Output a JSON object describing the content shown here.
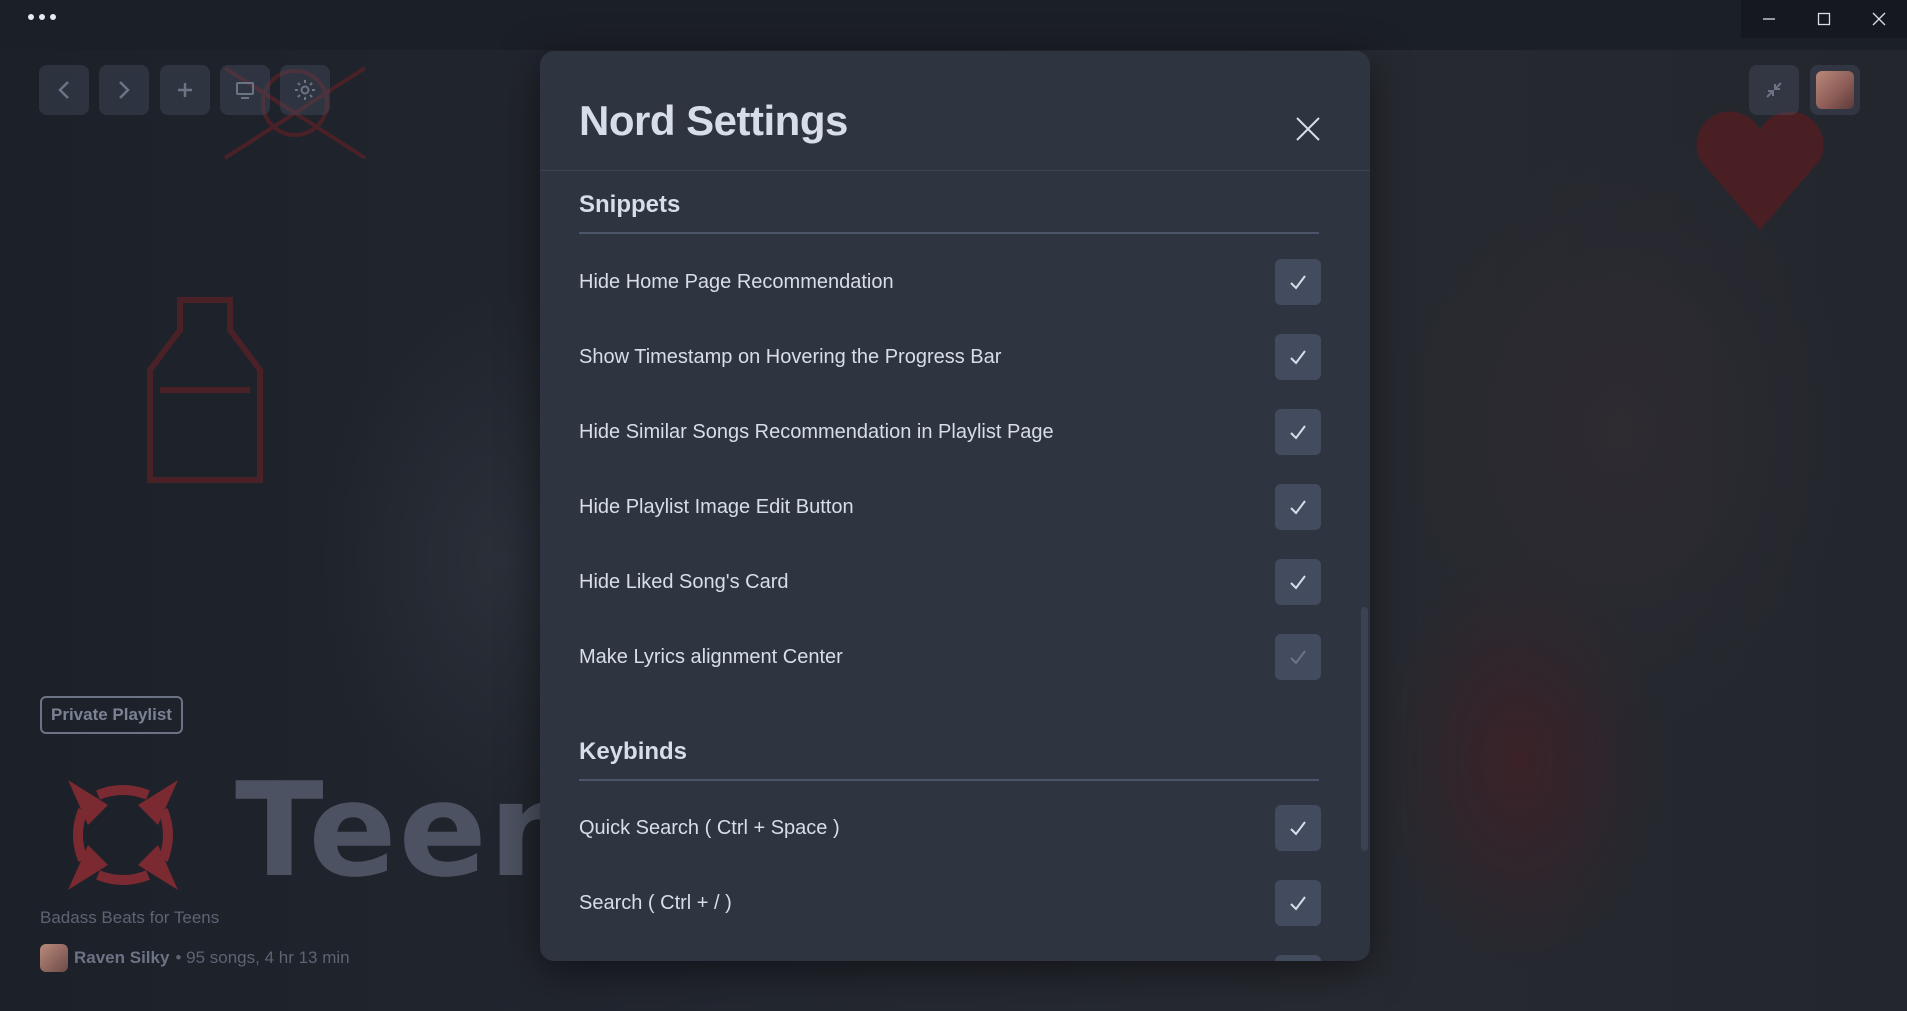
{
  "window": {
    "menu_icon": "more-dots-icon",
    "controls": [
      "minimize-icon",
      "maximize-icon",
      "close-icon"
    ]
  },
  "topbar": {
    "buttons": [
      "back-icon",
      "forward-icon",
      "plus-icon",
      "monitor-icon",
      "gear-icon"
    ],
    "right_buttons": [
      "minimize-arrows-icon",
      "user-avatar"
    ]
  },
  "playlist": {
    "badge": "Private Playlist",
    "title": "Teen",
    "description": "Badass Beats for Teens",
    "owner": "Raven Silky",
    "meta": "• 95 songs, 4 hr 13 min"
  },
  "modal": {
    "title": "Nord Settings",
    "sections": [
      {
        "title": "Snippets",
        "items": [
          {
            "label": "Hide Home Page Recommendation",
            "checked": true
          },
          {
            "label": "Show Timestamp on Hovering the Progress Bar",
            "checked": true
          },
          {
            "label": "Hide Similar Songs Recommendation in Playlist Page",
            "checked": true
          },
          {
            "label": "Hide Playlist Image Edit Button",
            "checked": true
          },
          {
            "label": "Hide Liked Song's Card",
            "checked": true
          },
          {
            "label": "Make Lyrics alignment Center",
            "checked": false
          }
        ]
      },
      {
        "title": "Keybinds",
        "items": [
          {
            "label": "Quick Search ( Ctrl + Space )",
            "checked": true
          },
          {
            "label": "Search ( Ctrl + / )",
            "checked": true
          }
        ]
      }
    ]
  },
  "colors": {
    "modal_bg": "#2e3440",
    "checkbox_bg": "#434c5e",
    "text": "#d8dee9",
    "accent_red": "#8f2d33"
  }
}
